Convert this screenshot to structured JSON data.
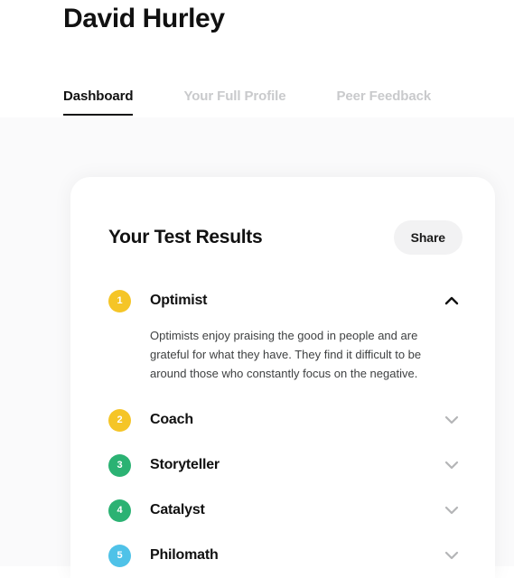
{
  "header": {
    "profile_name": "David Hurley",
    "tabs": [
      {
        "label": "Dashboard",
        "active": true
      },
      {
        "label": "Your Full Profile",
        "active": false
      },
      {
        "label": "Peer Feedback",
        "active": false
      }
    ]
  },
  "card": {
    "title": "Your Test Results",
    "share_label": "Share",
    "results": [
      {
        "rank": "1",
        "label": "Optimist",
        "color": "#f5c527",
        "expanded": true,
        "chevron_icon": "chevron-up-icon",
        "description": "Optimists enjoy praising the good in people and are grateful for what they have. They find it difficult to be around those who constantly focus on the negative."
      },
      {
        "rank": "2",
        "label": "Coach",
        "color": "#f5c527",
        "expanded": false,
        "chevron_icon": "chevron-down-icon",
        "description": ""
      },
      {
        "rank": "3",
        "label": "Storyteller",
        "color": "#2bb273",
        "expanded": false,
        "chevron_icon": "chevron-down-icon",
        "description": ""
      },
      {
        "rank": "4",
        "label": "Catalyst",
        "color": "#2bb273",
        "expanded": false,
        "chevron_icon": "chevron-down-icon",
        "description": ""
      },
      {
        "rank": "5",
        "label": "Philomath",
        "color": "#4fc2e8",
        "expanded": false,
        "chevron_icon": "chevron-down-icon",
        "description": ""
      }
    ]
  },
  "colors": {
    "page_background": "#fafafb",
    "card_background": "#ffffff",
    "accent_yellow": "#f5c527",
    "accent_green": "#2bb273",
    "accent_blue": "#4fc2e8",
    "text_primary": "#111111",
    "text_muted": "#c9cacc",
    "chevron_collapsed": "#b4b5b7"
  }
}
